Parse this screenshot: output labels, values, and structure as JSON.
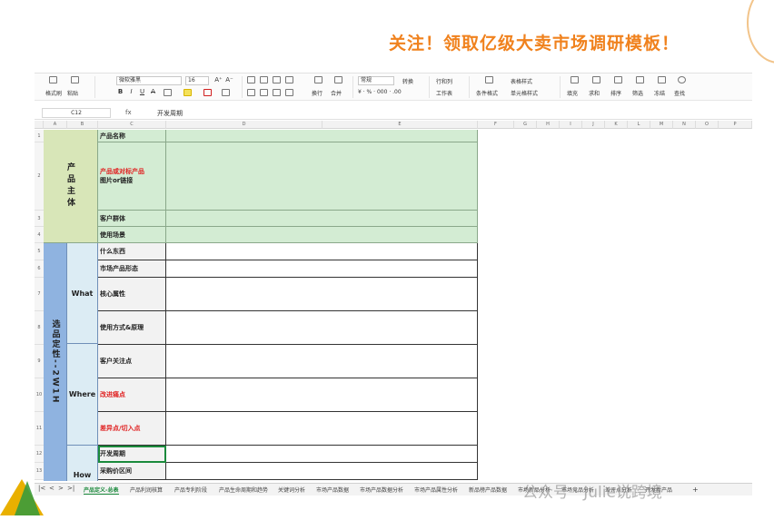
{
  "banner": {
    "text": "关注！领取亿级大卖市场调研模板！"
  },
  "ribbon": {
    "format_painter": "格式刷",
    "paste": "粘贴",
    "font_name": "微软雅黑",
    "font_size": "16",
    "grow_font": "A⁺",
    "shrink_font": "A⁻",
    "bold": "B",
    "italic": "I",
    "underline": "U",
    "strikethrough": "A",
    "wrap": "换行",
    "merge": "合并",
    "number_format": "常规",
    "convert": "转换",
    "rows_cols": "行和列",
    "worksheet": "工作表",
    "table_style": "表格样式",
    "cond_format": "条件格式",
    "cell_style": "单元格样式",
    "fill": "填充",
    "sum": "求和",
    "sort": "排序",
    "filter": "筛选",
    "freeze": "冻结",
    "find": "查找"
  },
  "formula_bar": {
    "cell_ref": "C12",
    "fx": "fx",
    "value": "开发周期"
  },
  "columns": [
    "A",
    "B",
    "C",
    "D",
    "E",
    "F",
    "G",
    "H",
    "I",
    "J",
    "K",
    "L",
    "M",
    "N",
    "O",
    "P"
  ],
  "rows": [
    "1",
    "2",
    "3",
    "4",
    "5",
    "6",
    "7",
    "8",
    "9",
    "10",
    "11",
    "12",
    "13"
  ],
  "sheet": {
    "product_main": "产品主体",
    "positioning": "选品定性--2W1H",
    "what": "What",
    "where": "Where",
    "how": "How",
    "items": {
      "r1": "产品名称",
      "r2a": "产品或对标产品",
      "r2b": "图片or链接",
      "r3": "客户群体",
      "r4": "使用场景",
      "r5": "什么东西",
      "r6": "市场产品形态",
      "r7": "核心属性",
      "r8": "使用方式&原理",
      "r9": "客户关注点",
      "r10": "改进痛点",
      "r11": "差异点/切入点",
      "r12": "开发周期",
      "r13": "采购价区间"
    }
  },
  "tabs": {
    "active": "产品定义-总表",
    "list": [
      "产品利润核算",
      "产品专利阶段",
      "产品生命周期和趋势",
      "关键词分析",
      "市场产品数据",
      "市场产品数据分析",
      "市场产品属性分析",
      "新品榜产品数据",
      "市场新品分析",
      "市场竞品分析",
      "差评点分析",
      "开发新产品"
    ]
  },
  "watermark": "公众号 · Julie说跨境"
}
